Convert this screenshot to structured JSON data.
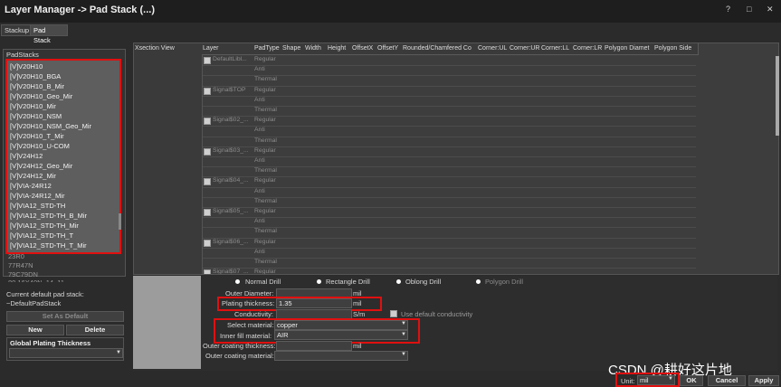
{
  "window": {
    "title": "Layer Manager -> Pad Stack (...)",
    "help_glyph": "?",
    "restore_glyph": "□",
    "close_glyph": "✕"
  },
  "tabs": [
    "Stackup",
    "Pad Stack"
  ],
  "padstacks": {
    "label": "PadStacks",
    "selected_items": [
      "[V]V20H10",
      "[V]V20H10_BGA",
      "[V]V20H10_B_Mir",
      "[V]V20H10_Geo_Mir",
      "[V]V20H10_Mir",
      "[V]V20H10_NSM",
      "[V]V20H10_NSM_Geo_Mir",
      "[V]V20H10_T_Mir",
      "[V]V20H10_U-COM",
      "[V]V24H12",
      "[V]V24H12_Geo_Mir",
      "[V]V24H12_Mir",
      "[V]VIA-24R12",
      "[V]VIA-24R12_Mir",
      "[V]VIA12_STD-TH",
      "[V]VIA12_STD-TH_B_Mir",
      "[V]VIA12_STD-TH_Mir",
      "[V]VIA12_STD-TH_T",
      "[V]VIA12_STD-TH_T_Mir"
    ],
    "other_items": [
      "23R0",
      "77R47N",
      "79C79DN",
      "80.16X40N_14_11"
    ]
  },
  "current_default": {
    "label": "Current default pad stack:",
    "value": "~DefaultPadStack"
  },
  "buttons": {
    "set_as_default": "Set As Default",
    "new": "New",
    "delete": "Delete",
    "ok": "OK",
    "cancel": "Cancel",
    "apply": "Apply"
  },
  "global_plating": {
    "label": "Global Plating Thickness",
    "value": ""
  },
  "grid": {
    "headers": [
      "Xsection View",
      "Layer",
      "PadType",
      "Shape",
      "Width",
      "Height",
      "OffsetX",
      "OffsetY",
      "Rounded/Chamfered Co",
      "Corner:UL",
      "Corner:UR",
      "Corner:LL",
      "Corner:LR",
      "Polygon Diamet",
      "Polygon Side"
    ],
    "layers": [
      {
        "name": "DefaultLibl...",
        "types": [
          "Regular",
          "Anti",
          "Thermal"
        ]
      },
      {
        "name": "Signal$TOP",
        "types": [
          "Regular",
          "Anti",
          "Thermal"
        ]
      },
      {
        "name": "Signal$02_...",
        "types": [
          "Regular",
          "Anti",
          "Thermal"
        ]
      },
      {
        "name": "Signal$03_...",
        "types": [
          "Regular",
          "Anti",
          "Thermal"
        ]
      },
      {
        "name": "Signal$04_...",
        "types": [
          "Regular",
          "Anti",
          "Thermal"
        ]
      },
      {
        "name": "Signal$05_...",
        "types": [
          "Regular",
          "Anti",
          "Thermal"
        ]
      },
      {
        "name": "Signal$06_...",
        "types": [
          "Regular",
          "Anti",
          "Thermal"
        ]
      },
      {
        "name": "Signal$07_...",
        "types": [
          "Regular"
        ]
      }
    ]
  },
  "drill": {
    "options": [
      "Normal Drill",
      "Rectangle Drill",
      "Oblong Drill",
      "Polygon Drill"
    ],
    "selected": "Normal Drill"
  },
  "form": {
    "outer_diameter": {
      "label": "Outer Diameter:",
      "value": "",
      "unit": "mil"
    },
    "plating_thickness": {
      "label": "Plating thickness:",
      "value": "1.35",
      "unit": "mil"
    },
    "conductivity": {
      "label": "Conductivity:",
      "value": "",
      "unit": "S/m"
    },
    "use_default_conductivity": {
      "label": "Use default conductivity",
      "checked": false
    },
    "select_material": {
      "label": "Select material:",
      "value": "copper"
    },
    "inner_fill_material": {
      "label": "Inner fill material:",
      "value": "AIR"
    },
    "outer_coating_thickness": {
      "label": "Outer coating thickness:",
      "value": "",
      "unit": "mil"
    },
    "outer_coating_material": {
      "label": "Outer coating material:",
      "value": ""
    }
  },
  "unit": {
    "label": "Unit:",
    "value": "mil"
  },
  "watermark": "CSDN @耕好这片地",
  "icons": {
    "dropdown": "chevron-down-icon",
    "checkbox": "checkbox-icon",
    "radio": "radio-icon"
  }
}
